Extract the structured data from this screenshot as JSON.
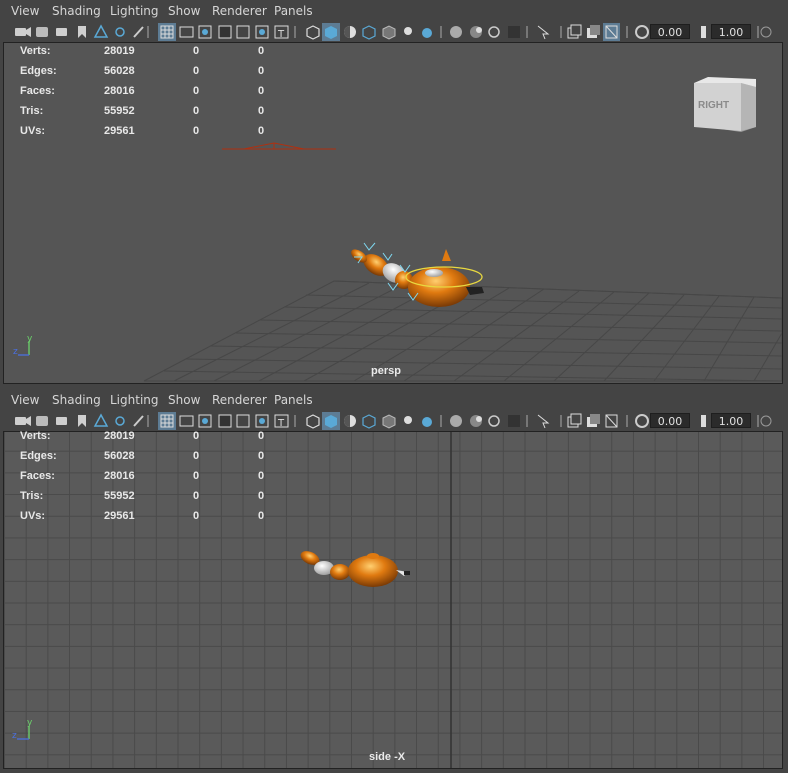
{
  "menu": [
    "View",
    "Shading",
    "Lighting",
    "Show",
    "Renderer",
    "Panels"
  ],
  "toolbar": {
    "field1_value": "0.00",
    "field2_value": "1.00",
    "icons": [
      "camera-select-icon",
      "camera-attributes-icon",
      "bookmark-icon",
      "image-plane-icon",
      "grid-icon",
      "film-gate-icon",
      "resolution-gate-icon",
      "gate-mask-icon",
      "field-chart-icon",
      "safe-action-icon",
      "safe-title-icon",
      "wireframe-icon",
      "smooth-shade-icon",
      "default-material-icon",
      "textured-icon",
      "use-all-lights-icon",
      "shadows-icon",
      "screen-space-ao-icon",
      "motion-blur-icon",
      "anti-aliasing-icon",
      "depth-of-field-icon",
      "isolate-select-icon",
      "xray-icon",
      "xray-joints-icon",
      "xray-components-icon",
      "exposure-icon",
      "gamma-icon"
    ]
  },
  "stats": {
    "labels": [
      "Verts:",
      "Edges:",
      "Faces:",
      "Tris:",
      "UVs:"
    ],
    "rows": [
      [
        "28019",
        "0",
        "0"
      ],
      [
        "56028",
        "0",
        "0"
      ],
      [
        "28016",
        "0",
        "0"
      ],
      [
        "55952",
        "0",
        "0"
      ],
      [
        "29561",
        "0",
        "0"
      ]
    ]
  },
  "top_panel": {
    "camera_label": "persp",
    "view_cube_label": "RIGHT"
  },
  "bottom_panel": {
    "camera_label": "side -X"
  },
  "axis": {
    "y": "y",
    "z": "z"
  },
  "colors": {
    "accent": "#5aa9d6",
    "model_orange": "#e07a10",
    "viewport_bg": "#555555"
  }
}
